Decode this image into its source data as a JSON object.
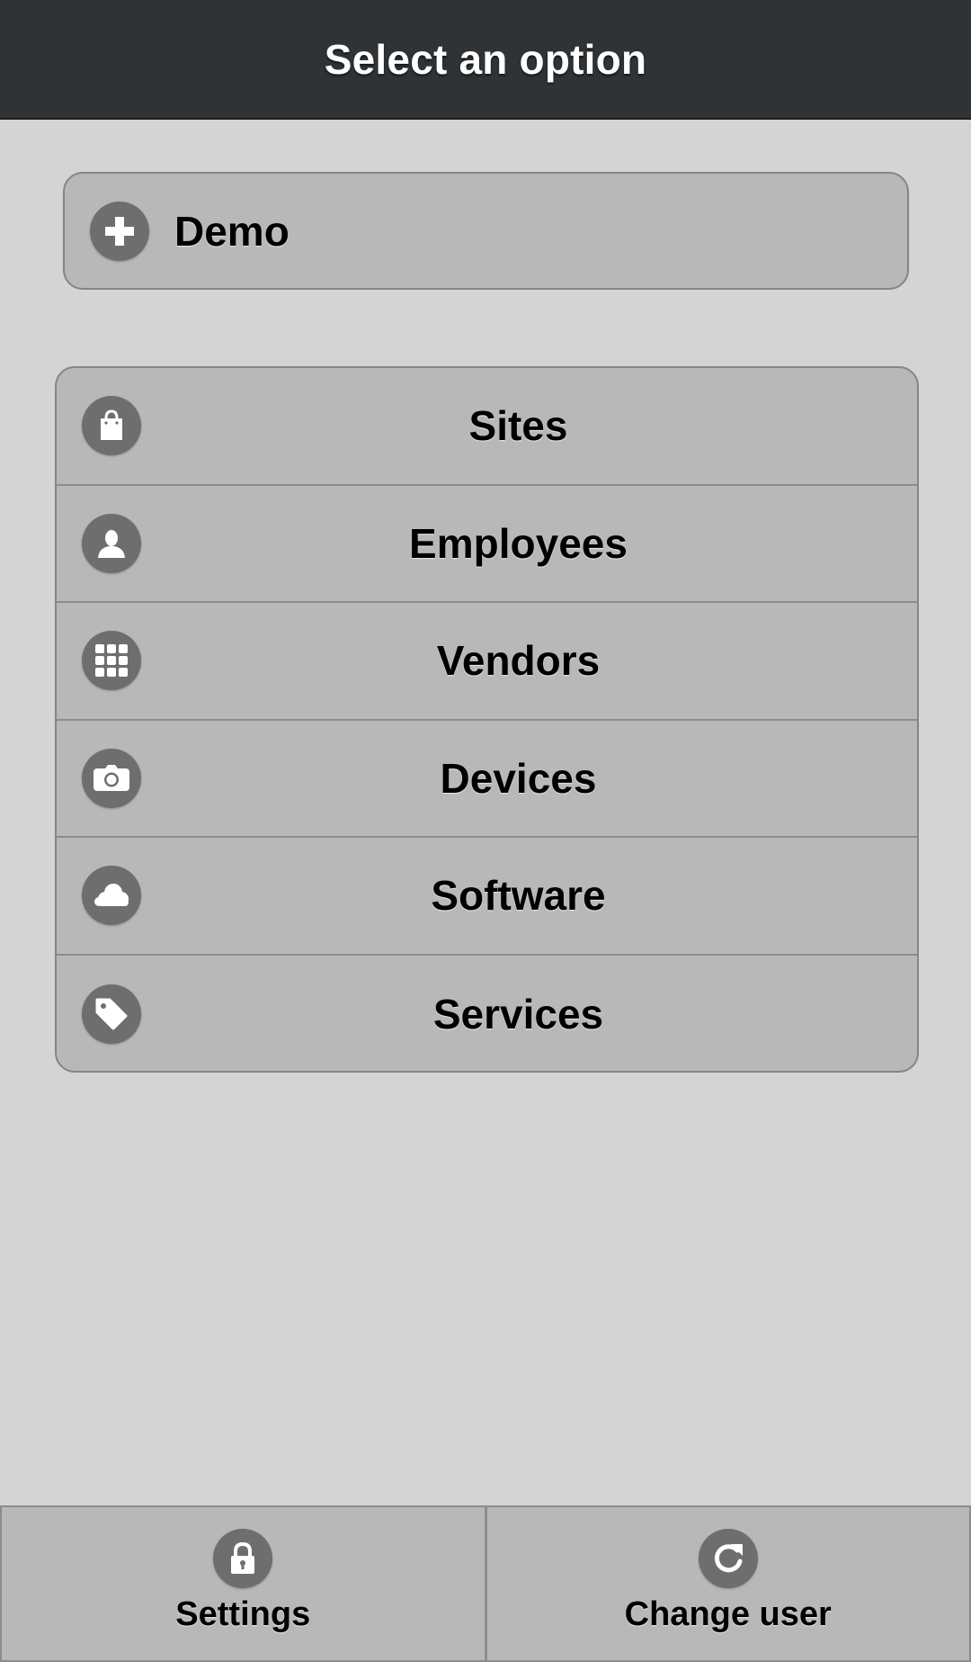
{
  "header": {
    "title": "Select an option"
  },
  "demo": {
    "label": "Demo",
    "icon": "plus-icon"
  },
  "menu": {
    "items": [
      {
        "label": "Sites",
        "icon": "shopping-bag-icon"
      },
      {
        "label": "Employees",
        "icon": "user-icon"
      },
      {
        "label": "Vendors",
        "icon": "grid-icon"
      },
      {
        "label": "Devices",
        "icon": "camera-icon"
      },
      {
        "label": "Software",
        "icon": "cloud-icon"
      },
      {
        "label": "Services",
        "icon": "tag-icon"
      }
    ]
  },
  "footer": {
    "settings": {
      "label": "Settings",
      "icon": "lock-icon"
    },
    "change_user": {
      "label": "Change user",
      "icon": "refresh-icon"
    }
  },
  "colors": {
    "header_bg": "#2f3336",
    "page_bg": "#d4d4d4",
    "button_bg": "#b8b8b8",
    "icon_bg": "#6e6e6e",
    "border": "#858585"
  }
}
